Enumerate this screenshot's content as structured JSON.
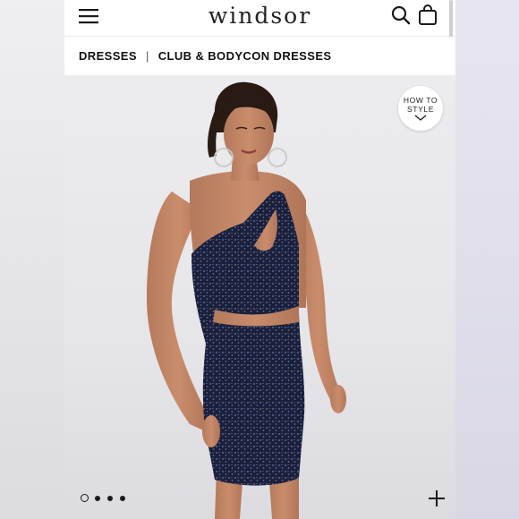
{
  "header": {
    "logo_text": "WINDSOR",
    "icons": {
      "menu": "hamburger-menu-icon",
      "search": "search-icon",
      "bag": "shopping-bag-icon"
    }
  },
  "breadcrumb": {
    "category": "DRESSES",
    "separator": "|",
    "subcategory": "CLUB & BODYCON DRESSES"
  },
  "product_gallery": {
    "how_to_style": {
      "line1": "HOW TO",
      "line2": "STYLE",
      "icon": "chevron-down-icon"
    },
    "image_count": 4,
    "active_index": 0,
    "zoom_icon": "plus-icon"
  },
  "colors": {
    "dress": "#1a2038",
    "sequin": "#3a4a7a",
    "background": "#e9e9eb",
    "text": "#111111"
  }
}
